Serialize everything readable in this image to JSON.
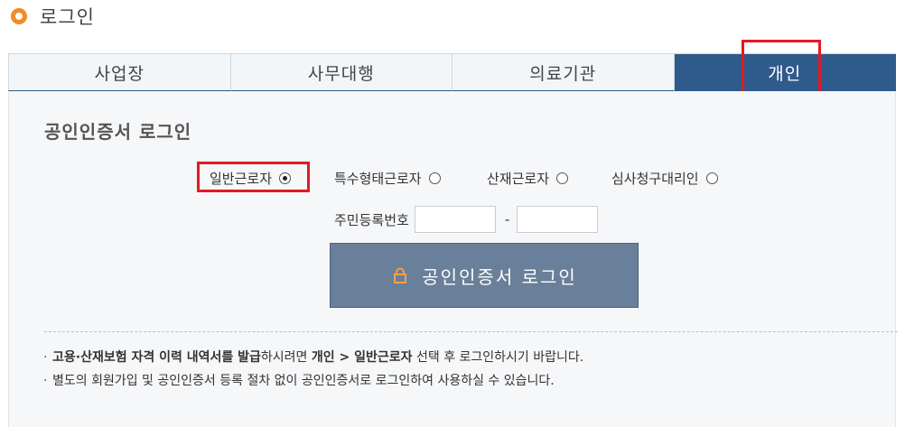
{
  "header": {
    "title": "로그인"
  },
  "tabs": [
    {
      "label": "사업장",
      "active": false
    },
    {
      "label": "사무대행",
      "active": false
    },
    {
      "label": "의료기관",
      "active": false
    },
    {
      "label": "개인",
      "active": true
    }
  ],
  "section": {
    "title": "공인인증서 로그인"
  },
  "radios": [
    {
      "label": "일반근로자",
      "checked": true
    },
    {
      "label": "특수형태근로자",
      "checked": false
    },
    {
      "label": "산재근로자",
      "checked": false
    },
    {
      "label": "심사청구대리인",
      "checked": false
    }
  ],
  "rrn": {
    "label": "주민등록번호",
    "dash": "-",
    "first_value": "",
    "second_value": ""
  },
  "login_button": {
    "label": "공인인증서 로그인"
  },
  "notes": {
    "bullet": "·",
    "note1": {
      "bold1": "고용·산재보험 자격 이력 내역서를 발급",
      "text1": "하시려면 ",
      "bold2": "개인 > 일반근로자",
      "text2": " 선택 후 로그인하시기 바랍니다."
    },
    "note2": {
      "text": "별도의 회원가입 및 공인인증서 등록 절차 없이 공인인증서로 로그인하여 사용하실 수 있습니다."
    }
  },
  "colors": {
    "accent_orange": "#f28c28",
    "active_tab": "#2e5a8c",
    "button": "#6a7f99",
    "highlight_red": "#e11b22"
  }
}
